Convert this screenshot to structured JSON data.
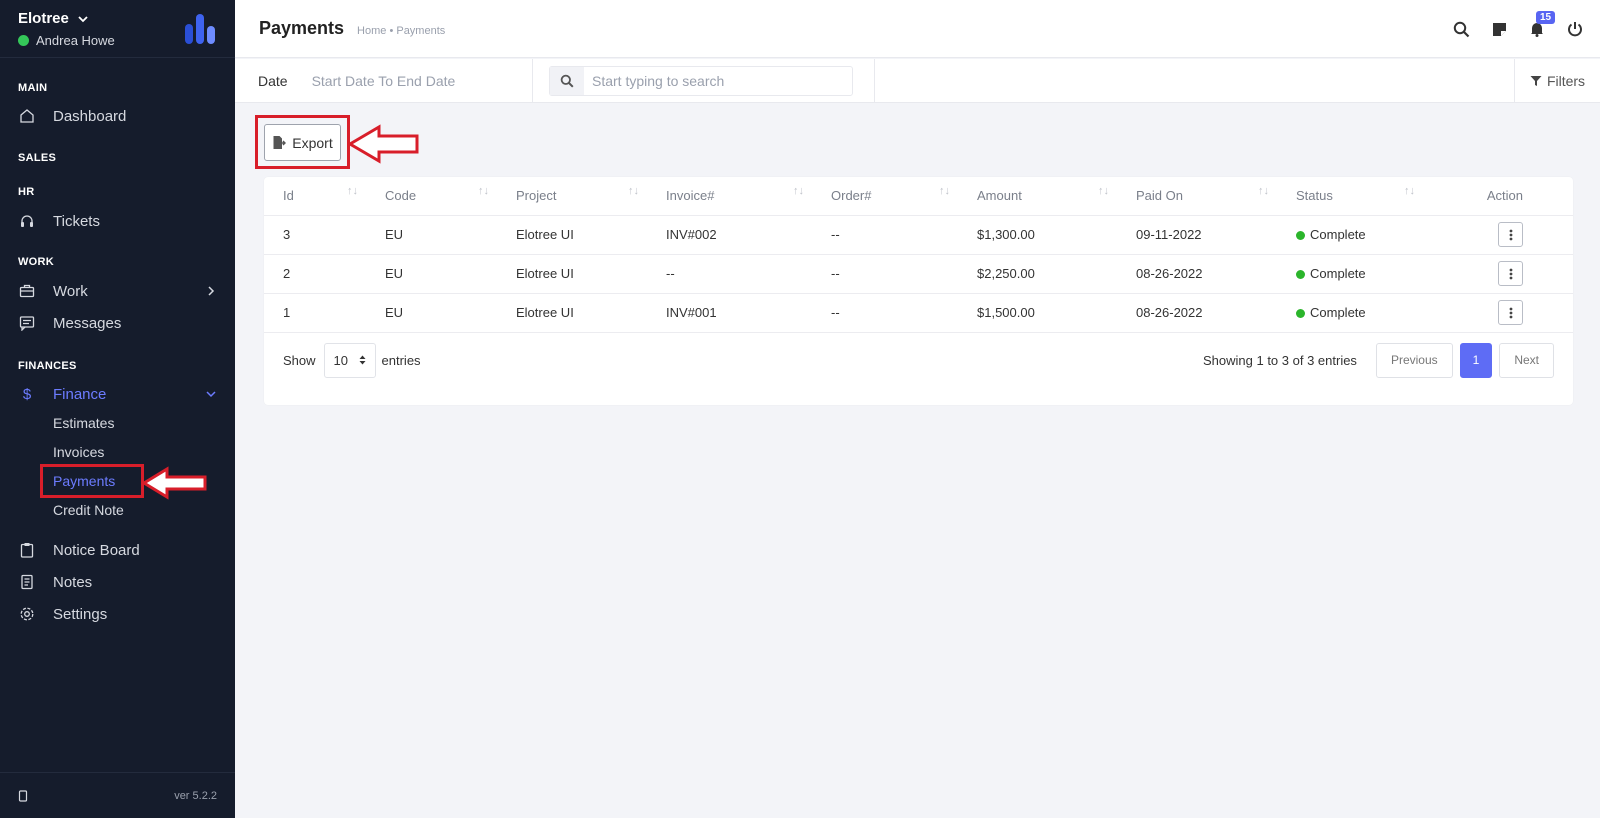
{
  "sidebar": {
    "company": "Elotree",
    "user": "Andrea Howe",
    "sections": {
      "main": "MAIN",
      "sales": "SALES",
      "hr": "HR",
      "work": "WORK",
      "finances": "FINANCES"
    },
    "items": {
      "dashboard": "Dashboard",
      "tickets": "Tickets",
      "work": "Work",
      "messages": "Messages",
      "finance": "Finance",
      "notice_board": "Notice Board",
      "notes": "Notes",
      "settings": "Settings"
    },
    "finance_sub": {
      "estimates": "Estimates",
      "invoices": "Invoices",
      "payments": "Payments",
      "credit_note": "Credit Note"
    },
    "version": "ver 5.2.2"
  },
  "header": {
    "title": "Payments",
    "breadcrumb": "Home • Payments",
    "notification_count": "15"
  },
  "filterbar": {
    "date_label": "Date",
    "date_value": "Start Date To End Date",
    "search_placeholder": "Start typing to search",
    "filters_label": "Filters"
  },
  "export_label": "Export",
  "table": {
    "columns": [
      "Id",
      "Code",
      "Project",
      "Invoice#",
      "Order#",
      "Amount",
      "Paid On",
      "Status",
      "Action"
    ],
    "rows": [
      {
        "id": "3",
        "code": "EU",
        "project": "Elotree UI",
        "invoice": "INV#002",
        "order": "--",
        "amount": "$1,300.00",
        "paid_on": "09-11-2022",
        "status": "Complete"
      },
      {
        "id": "2",
        "code": "EU",
        "project": "Elotree UI",
        "invoice": "--",
        "order": "--",
        "amount": "$2,250.00",
        "paid_on": "08-26-2022",
        "status": "Complete"
      },
      {
        "id": "1",
        "code": "EU",
        "project": "Elotree UI",
        "invoice": "INV#001",
        "order": "--",
        "amount": "$1,500.00",
        "paid_on": "08-26-2022",
        "status": "Complete"
      }
    ],
    "footer": {
      "show": "Show",
      "page_length": "10",
      "entries": "entries",
      "info": "Showing 1 to 3 of 3 entries",
      "previous": "Previous",
      "current_page": "1",
      "next": "Next"
    }
  },
  "colors": {
    "sidebar_bg": "#151c2c",
    "accent": "#5e6cf5",
    "status_complete": "#2bb52b",
    "annotation": "#d81e2a"
  }
}
